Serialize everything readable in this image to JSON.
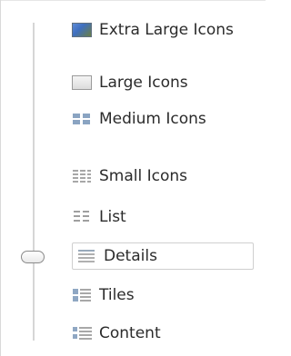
{
  "view_menu": {
    "items": [
      {
        "label": "Extra Large Icons",
        "icon": "extra-large-icons-icon"
      },
      {
        "label": "Large Icons",
        "icon": "large-icons-icon"
      },
      {
        "label": "Medium Icons",
        "icon": "medium-icons-icon"
      },
      {
        "label": "Small Icons",
        "icon": "small-icons-icon"
      },
      {
        "label": "List",
        "icon": "list-view-icon"
      },
      {
        "label": "Details",
        "icon": "details-view-icon",
        "selected": true
      },
      {
        "label": "Tiles",
        "icon": "tiles-view-icon"
      },
      {
        "label": "Content",
        "icon": "content-view-icon"
      }
    ]
  }
}
